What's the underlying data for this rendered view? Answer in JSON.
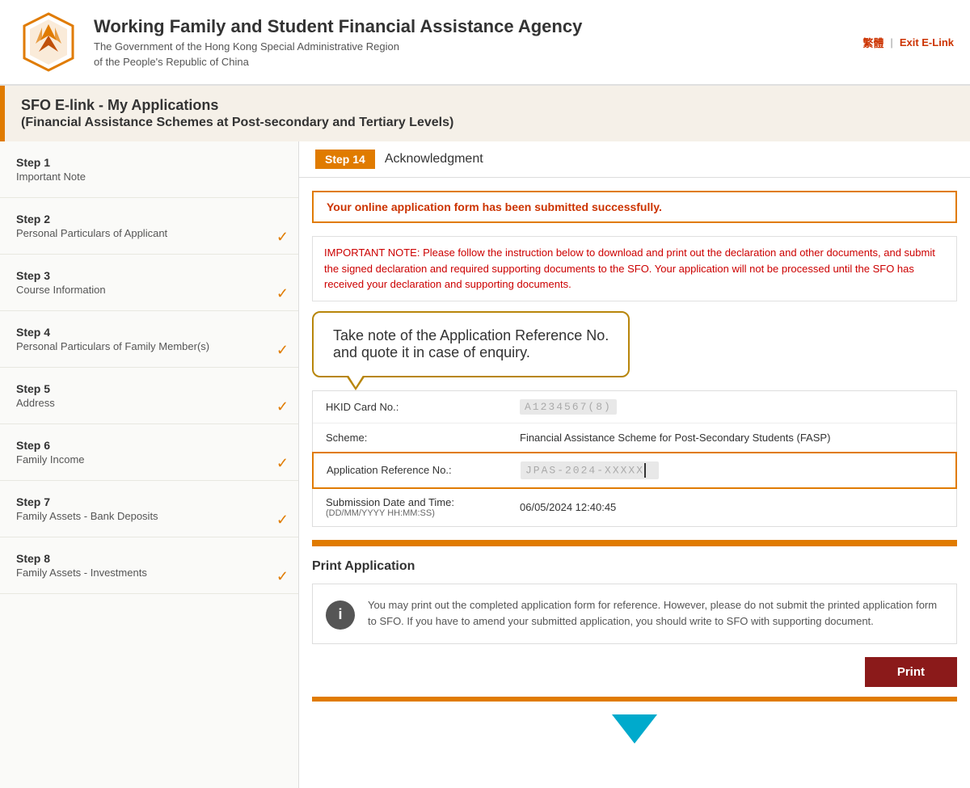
{
  "header": {
    "title": "Working Family and Student Financial Assistance Agency",
    "subtitle_line1": "The Government of the Hong Kong Special Administrative Region",
    "subtitle_line2": "of the People's Republic of China",
    "lang_link": "繁體",
    "exit_link": "Exit E-Link"
  },
  "page_title": {
    "line1": "SFO E-link - My Applications",
    "line2": "(Financial Assistance Schemes at Post-secondary and Tertiary Levels)"
  },
  "sidebar": {
    "items": [
      {
        "step": "Step 1",
        "desc": "Important Note",
        "has_check": false
      },
      {
        "step": "Step 2",
        "desc": "Personal Particulars of Applicant",
        "has_check": true
      },
      {
        "step": "Step 3",
        "desc": "Course Information",
        "has_check": true
      },
      {
        "step": "Step 4",
        "desc": "Personal Particulars of Family Member(s)",
        "has_check": true
      },
      {
        "step": "Step 5",
        "desc": "Address",
        "has_check": true
      },
      {
        "step": "Step 6",
        "desc": "Family Income",
        "has_check": true
      },
      {
        "step": "Step 7",
        "desc": "Family Assets - Bank Deposits",
        "has_check": true
      },
      {
        "step": "Step 8",
        "desc": "Family Assets - Investments",
        "has_check": true
      }
    ]
  },
  "content": {
    "step_badge": "Step 14",
    "step_title": "Acknowledgment",
    "success_message": "Your online application form has been submitted successfully.",
    "important_note": "IMPORTANT NOTE: Please follow the instruction below to download and print out the declaration and other documents, and submit the signed declaration and required supporting documents to the SFO. Your application will not be processed until the SFO has received your declaration and supporting documents.",
    "tooltip_text_line1": "Take note of the Application Reference No.",
    "tooltip_text_line2": "and quote it in case of enquiry.",
    "fields": {
      "hkid_label": "HKID Card No.:",
      "hkid_value": "A1234567(8)",
      "scheme_label": "Scheme:",
      "scheme_value": "Financial Assistance Scheme for Post-Secondary Students (FASP)",
      "app_ref_label": "Application Reference No.:",
      "app_ref_value": "JPAS-2024-XXXXX",
      "submission_label": "Submission Date and Time:",
      "submission_sub": "(DD/MM/YYYY HH:MM:SS)",
      "submission_value": "06/05/2024 12:40:45"
    },
    "print_section": {
      "title": "Print Application",
      "info_text": "You may print out the completed application form for reference. However, please do not submit the printed application form to SFO. If you have to amend your submitted application, you should write to SFO with supporting document.",
      "print_button": "Print"
    }
  }
}
